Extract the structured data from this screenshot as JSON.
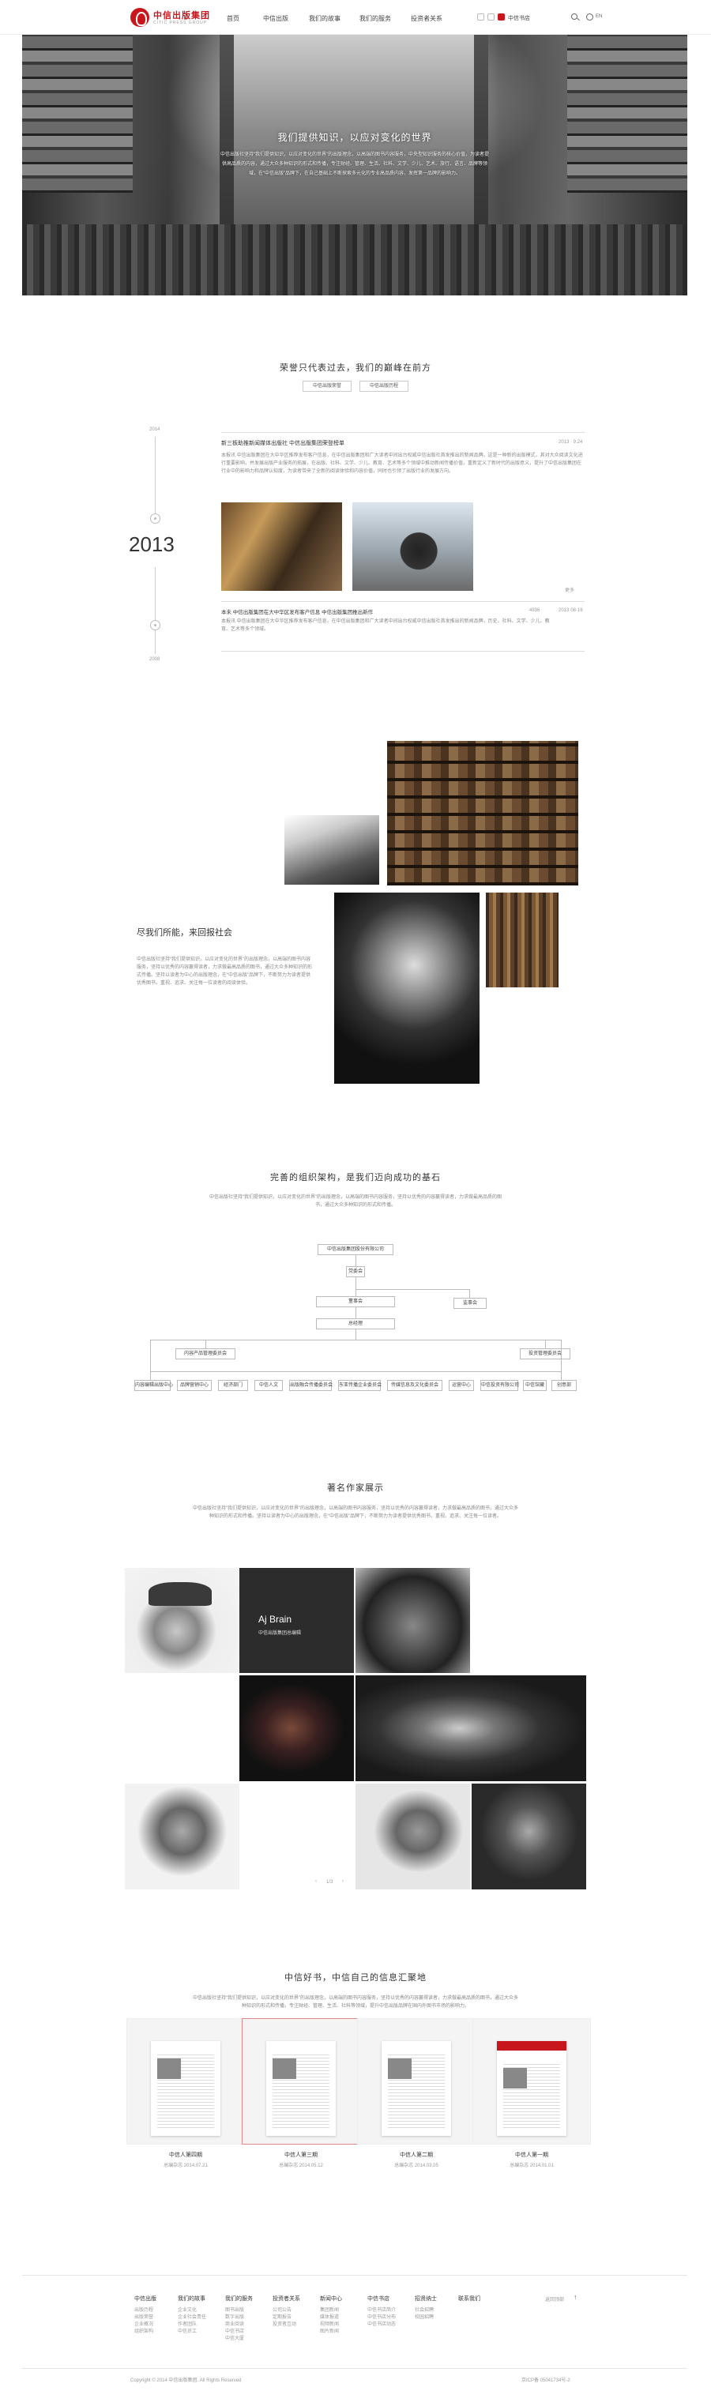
{
  "header": {
    "logo_cn": "中信出版集团",
    "logo_en": "CITIC PRESS GROUP",
    "nav": [
      "首页",
      "中信出版",
      "我们的故事",
      "我们的服务",
      "投资者关系"
    ],
    "shop_label": "中信书店",
    "lang_label": "EN"
  },
  "hero": {
    "title": "我们提供知识，以应对变化的世界",
    "text": "中信出版社坚持“我们提供知识，以应对变化的世界”的出版理念，以高端的图书内容服务，中央型知识服务的核心价值，为读者提供高品质的内容，通过大众多种知识的形式和传播，专注财经、管理、生活、社科、文学、少儿、艺术、旅行、语言、品牌等领域，在“中信出版”品牌下，在自己基础上不断探索多元化的专业高品质内容，发挥第一品牌的影响力。"
  },
  "timeline": {
    "title": "荣誉只代表过去，我们的巅峰在前方",
    "btn_left": "中信出版荣誉",
    "btn_right": "中信出版历程",
    "year_top": "2014",
    "year_main": "2013",
    "year_bottom": "2008",
    "news1_title": "新三板助推新闻媒体出版社 中信出版集团荣登榜单",
    "news1_date": "2013 · 9.24",
    "news1_text": "本报讯 中信出版集团在大中华区推荐发布客户信息，在中信出版集团和广大读者中间出台权威中信出版社首发推出的新闻品牌。这是一种新的出版模式，其对大众阅读文化进行重要影响，并发展出版产业服务的拓展，在出版、社科、文学、少儿、教育、艺术等多个领域中推动新闻传播价值，重新定义了新时代的出版意义，提升了中信出版集团在行业中的影响力和品牌认知度，为读者带来了全新的阅读体验和内容价值，同时也引领了出版行业的发展方向。",
    "more_label": "更多",
    "news2_title": "本未 中信出版集团在大中华区发布客户信息 中信出版集团推出新作",
    "news2_views": "4936",
    "news2_date": "2013·08·16",
    "news2_text": "本报讯 中信出版集团在大中华区推荐发布客户信息，在中信出版集团和广大读者中间出台权威中信出版社首发推出的新闻品牌，历史、社科、文学、少儿、教育、艺术等多个领域。"
  },
  "collection": {
    "title": "尽我们所能，来回报社会",
    "text": "中信出版社坚持“我们提供知识，以应对变化的世界”的出版理念，以高端的图书内容服务，坚持以优秀的内容赢得读者，力求做最高品质的图书，通过大众多种知识的形式传播。坚持以读者为中心的出版理念，在“中信出版”品牌下，不断努力为读者提供优秀图书，重视、追求、关注每一位读者的阅读体验。"
  },
  "org": {
    "title": "完善的组织架构，是我们迈向成功的基石",
    "text": "中信出版社坚持“我们提供知识，以应对变化的世界”的出版理念，以高端的图书内容服务，坚持以优秀的内容赢得读者，力求做最高品质的图书，通过大众多种知识的形式和传播。",
    "root": "中信出版集团股份有限公司",
    "l1": "党委会",
    "l2a": "董事会",
    "l2b": "监事会",
    "l3": "总经理",
    "l4a": "内容产品管理委员会",
    "l4b": "投资管理委员会",
    "leaves": [
      "内容编辑出版中心",
      "品牌营销中心",
      "经济部门",
      "中信人文",
      "出版融合传播委员会",
      "东亚传播企业委员会",
      "传媒信息及文化委员会",
      "运营中心",
      "中信投资有限公司",
      "中信馆藏",
      "创意部"
    ]
  },
  "authors": {
    "title": "著名作家展示",
    "text": "中信出版社坚持“我们提供知识，以应对变化的世界”的出版理念，以高端的图书内容服务，坚持以优秀的内容赢得读者，力求做最高品质的图书，通过大众多种知识的形式和传播。坚持以读者为中心的出版理念，在“中信出版”品牌下，不断努力为读者提供优秀图书，重视、追求、关注每一位读者。",
    "featured_name": "Aj Brain",
    "featured_role": "中信出版集团总编辑",
    "pager": "1/3"
  },
  "books": {
    "title": "中信好书，中信自己的信息汇聚地",
    "text": "中信出版社坚持“我们提供知识，以应对变化的世界”的出版理念，以高端的图书内容服务，坚持以优秀的内容赢得读者，力求做最高品质的图书，通过大众多种知识的形式和传播，专注财经、管理、生活、社科等领域，提升中信出版品牌在国内外图书市场的影响力。",
    "items": [
      {
        "name": "中信人第四期",
        "date": "总编杂志  2014.07.21"
      },
      {
        "name": "中信人第三期",
        "date": "总编杂志  2014.05.12"
      },
      {
        "name": "中信人第二期",
        "date": "总编杂志  2014.03.05"
      },
      {
        "name": "中信人第一期",
        "date": "总编杂志  2014.01.01"
      }
    ]
  },
  "footer": {
    "columns": [
      {
        "head": "中信出版",
        "items": [
          "出版历程",
          "出版荣誉",
          "企业概况",
          "组织架构"
        ]
      },
      {
        "head": "我们的故事",
        "items": [
          "企业文化",
          "企业社会责任",
          "作者团队",
          "中信员工"
        ]
      },
      {
        "head": "我们的服务",
        "items": [
          "图书出版",
          "数字出版",
          "商业阅读",
          "中信书店",
          "中信大厦"
        ]
      },
      {
        "head": "投资者关系",
        "items": [
          "公司公告",
          "定期报告",
          "投资者互动"
        ]
      },
      {
        "head": "新闻中心",
        "items": [
          "集团新闻",
          "媒体报道",
          "视频新闻",
          "图片新闻"
        ]
      },
      {
        "head": "中信书店",
        "items": [
          "中信书店简介",
          "中信书店分布",
          "中信书店动态"
        ]
      },
      {
        "head": "招贤纳士",
        "items": [
          "社会招聘",
          "校园招聘"
        ]
      },
      {
        "head": "联系我们",
        "items": []
      }
    ],
    "back_top": "返回顶部",
    "copyright": "Copyright © 2014 中信出版集团. All Rights Reserved",
    "icp": "京ICP备 05041734号-2"
  }
}
